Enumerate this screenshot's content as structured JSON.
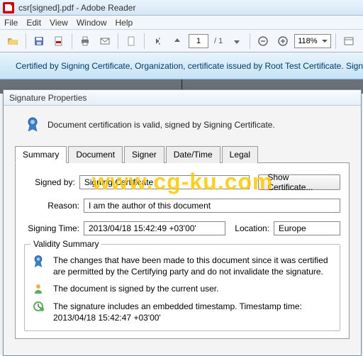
{
  "window": {
    "title": "csr[signed].pdf - Adobe Reader"
  },
  "menu": {
    "file": "File",
    "edit": "Edit",
    "view": "View",
    "window": "Window",
    "help": "Help"
  },
  "toolbar": {
    "page_current": "1",
    "page_total": "/ 1",
    "zoom": "118%"
  },
  "cert_bar": {
    "text": "Certified by Signing Certificate, Organization, certificate issued by Root Test Certificate. Signed and"
  },
  "dialog": {
    "title": "Signature Properties",
    "header": "Document certification is valid, signed by Signing Certificate.",
    "tabs": {
      "summary": "Summary",
      "document": "Document",
      "signer": "Signer",
      "datetime": "Date/Time",
      "legal": "Legal"
    },
    "labels": {
      "signed_by": "Signed by:",
      "reason": "Reason:",
      "signing_time": "Signing Time:",
      "location": "Location:"
    },
    "values": {
      "signed_by": "Signing Certificate",
      "reason": "I am the author of this document",
      "signing_time": "2013/04/18 15:42:49 +03'00'",
      "location": "Europe"
    },
    "show_cert_btn": "Show Certificate...",
    "validity": {
      "title": "Validity Summary",
      "line1": "The changes that have been made to this document since it was certified are permitted by the Certifying party and do not invalidate the signature.",
      "line2": "The document is signed by the current user.",
      "line3a": "The signature includes an embedded timestamp. Timestamp time:",
      "line3b": "2013/04/18 15:42:47 +03'00'"
    }
  },
  "watermark": "www.cg-ku.com"
}
